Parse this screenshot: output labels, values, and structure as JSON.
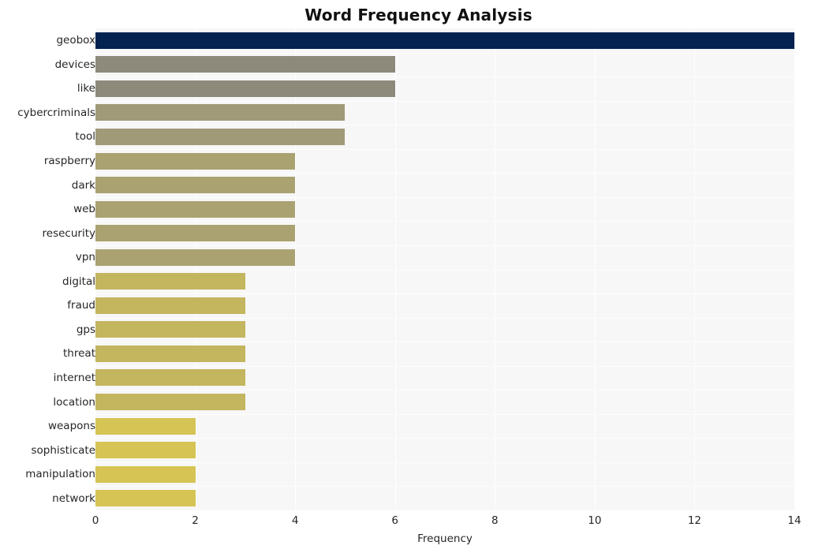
{
  "chart_data": {
    "type": "bar",
    "orientation": "horizontal",
    "title": "Word Frequency Analysis",
    "xlabel": "Frequency",
    "ylabel": "",
    "xlim": [
      0,
      14
    ],
    "ylim": null,
    "grid": true,
    "legend": null,
    "xticks": [
      0,
      2,
      4,
      6,
      8,
      10,
      12,
      14
    ],
    "xtick_labels": [
      "0",
      "2",
      "4",
      "6",
      "8",
      "10",
      "12",
      "14"
    ],
    "categories": [
      "geobox",
      "devices",
      "like",
      "cybercriminals",
      "tool",
      "raspberry",
      "dark",
      "web",
      "resecurity",
      "vpn",
      "digital",
      "fraud",
      "gps",
      "threat",
      "internet",
      "location",
      "weapons",
      "sophisticate",
      "manipulation",
      "network"
    ],
    "values": [
      14,
      6,
      6,
      5,
      5,
      4,
      4,
      4,
      4,
      4,
      3,
      3,
      3,
      3,
      3,
      3,
      2,
      2,
      2,
      2
    ],
    "bar_colors": [
      "#042350",
      "#8d8a7c",
      "#8d8a7c",
      "#a09a78",
      "#a09a78",
      "#aaa271",
      "#aaa271",
      "#aaa271",
      "#aaa271",
      "#aaa271",
      "#c4b55f",
      "#c4b55f",
      "#c4b55f",
      "#c4b55f",
      "#c4b55f",
      "#c4b55f",
      "#d6c455",
      "#d6c455",
      "#d6c455",
      "#d6c455"
    ],
    "plot_background": "#f7f7f7",
    "figure_background": "#ffffff",
    "gridline_color": "#ffffff",
    "text_color": "#262626"
  }
}
